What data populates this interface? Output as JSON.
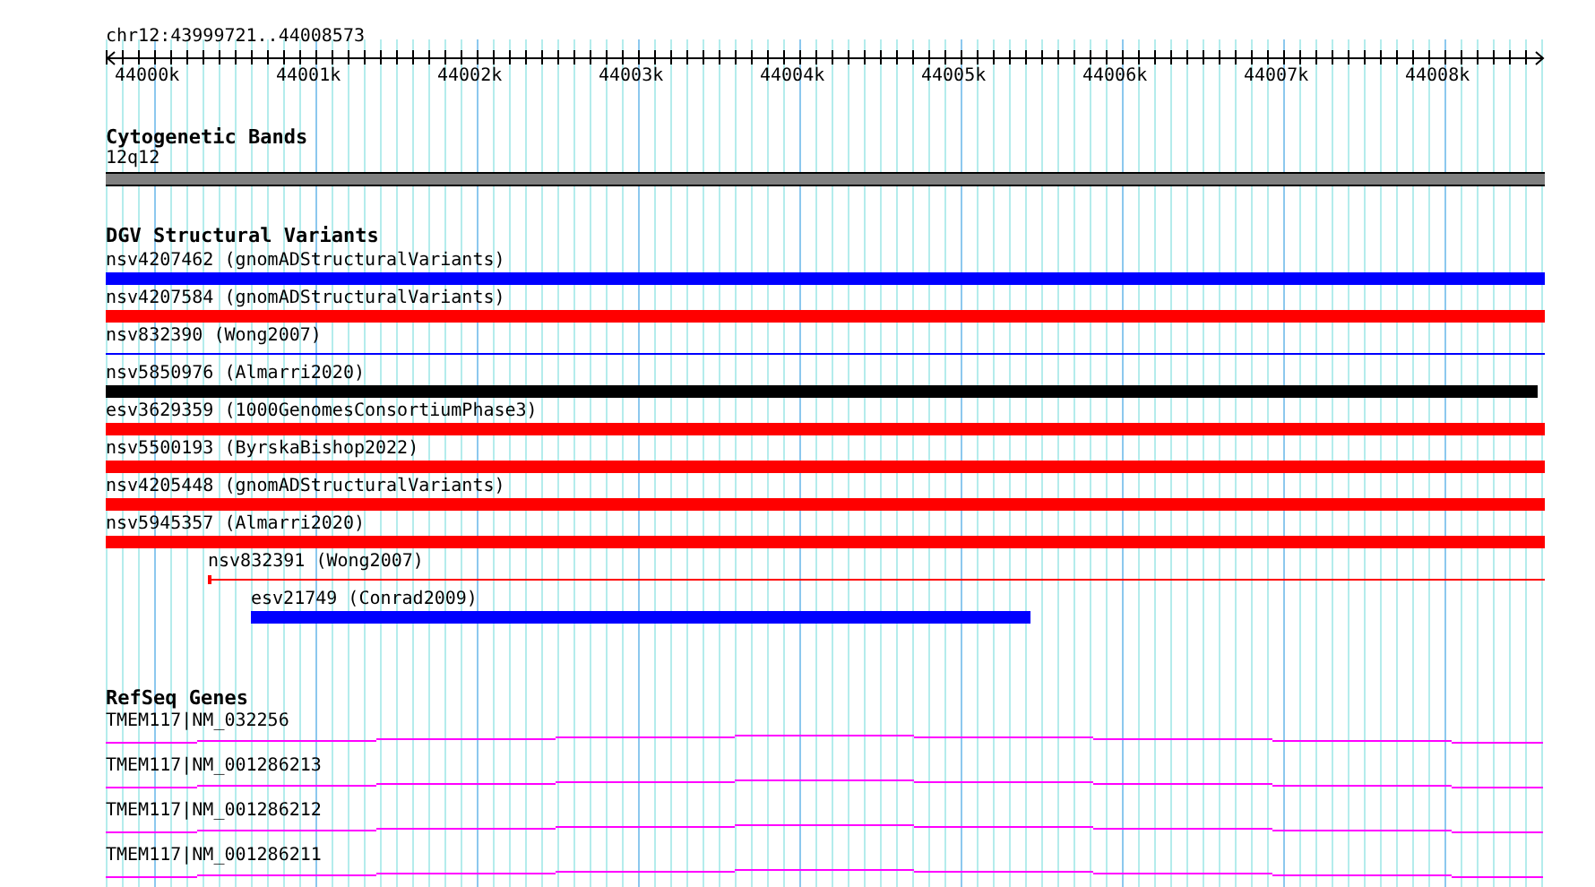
{
  "ruler": {
    "location": "chr12:43999721..44008573",
    "ticks": [
      "44000k",
      "44001k",
      "44002k",
      "44003k",
      "44004k",
      "44005k",
      "44006k",
      "44007k",
      "44008k"
    ]
  },
  "cytobands": {
    "title": "Cytogenetic Bands",
    "bands": [
      {
        "label": "12q12",
        "color": "#808080"
      }
    ]
  },
  "variants": {
    "title": "DGV Structural Variants",
    "items": [
      {
        "label": "nsv4207462 (gnomADStructuralVariants)",
        "color": "#0000ff",
        "kind": "thick"
      },
      {
        "label": "nsv4207584 (gnomADStructuralVariants)",
        "color": "#ff0000",
        "kind": "thick"
      },
      {
        "label": "nsv832390 (Wong2007)",
        "color": "#0000ff",
        "kind": "thin"
      },
      {
        "label": "nsv5850976 (Almarri2020)",
        "color": "#000000",
        "kind": "thick"
      },
      {
        "label": "esv3629359 (1000GenomesConsortiumPhase3)",
        "color": "#ff0000",
        "kind": "thick"
      },
      {
        "label": "nsv5500193 (ByrskaBishop2022)",
        "color": "#ff0000",
        "kind": "thick"
      },
      {
        "label": "nsv4205448 (gnomADStructuralVariants)",
        "color": "#ff0000",
        "kind": "thick"
      },
      {
        "label": "nsv5945357 (Almarri2020)",
        "color": "#ff0000",
        "kind": "thick"
      },
      {
        "label": "nsv832391 (Wong2007)",
        "color": "#ff0000",
        "kind": "thin"
      },
      {
        "label": "esv21749 (Conrad2009)",
        "color": "#0000ff",
        "kind": "thick"
      }
    ]
  },
  "genes": {
    "title": "RefSeq Genes",
    "items": [
      {
        "label": "TMEM117|NM_032256"
      },
      {
        "label": "TMEM117|NM_001286213"
      },
      {
        "label": "TMEM117|NM_001286212"
      },
      {
        "label": "TMEM117|NM_001286211"
      }
    ]
  }
}
